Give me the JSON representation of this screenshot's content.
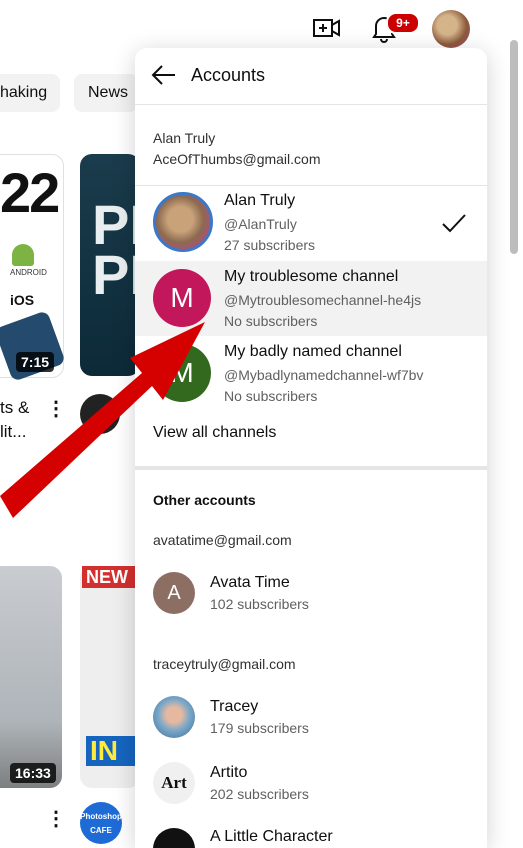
{
  "topbar": {
    "create_icon": "video-plus-icon",
    "notifications_icon": "bell-icon",
    "notifications_badge": "9+"
  },
  "chips": [
    "haking",
    "News"
  ],
  "background": {
    "thumb1_big_text": "22",
    "thumb1_android_text": "ANDROID",
    "thumb1_ios_text": "iOS",
    "thumb1_duration": "7:15",
    "thumb2_text": "PR\nPL",
    "side_title_line1": "ts &",
    "side_title_line2": "lit...",
    "thumb3_duration": "16:33",
    "thumb4_banner": "NEW",
    "thumb4_in": "IN",
    "channel_logo_text": "Photoshop CAFE"
  },
  "panel": {
    "title": "Accounts",
    "current_account": {
      "name": "Alan Truly",
      "email": "AceOfThumbs@gmail.com"
    },
    "channels": [
      {
        "name": "Alan Truly",
        "handle": "@AlanTruly",
        "subs": "27 subscribers",
        "avatar_letter": "",
        "selected": true
      },
      {
        "name": "My troublesome channel",
        "handle": "@Mytroublesomechannel-he4js",
        "subs": "No subscribers",
        "avatar_letter": "M",
        "color": "#c2185b"
      },
      {
        "name": "My badly named channel",
        "handle": "@Mybadlynamedchannel-wf7bv",
        "subs": "No subscribers",
        "avatar_letter": "M",
        "color": "#33691e"
      }
    ],
    "view_all": "View all channels",
    "other_accounts_header": "Other accounts",
    "other_groups": [
      {
        "email": "avatatime@gmail.com",
        "accounts": [
          {
            "name": "Avata Time",
            "subs": "102 subscribers",
            "avatar_letter": "A",
            "color": "#8d6e63"
          }
        ]
      },
      {
        "email": "traceytruly@gmail.com",
        "accounts": [
          {
            "name": "Tracey",
            "subs": "179 subscribers",
            "avatar_letter": ""
          },
          {
            "name": "Artito",
            "subs": "202 subscribers",
            "avatar_letter": "Art"
          },
          {
            "name": "A Little Character",
            "subs": "",
            "avatar_letter": ""
          }
        ]
      }
    ]
  },
  "colors": {
    "badge": "#cc0000",
    "arrow": "#d50000",
    "active_row": "#f2f2f2"
  }
}
